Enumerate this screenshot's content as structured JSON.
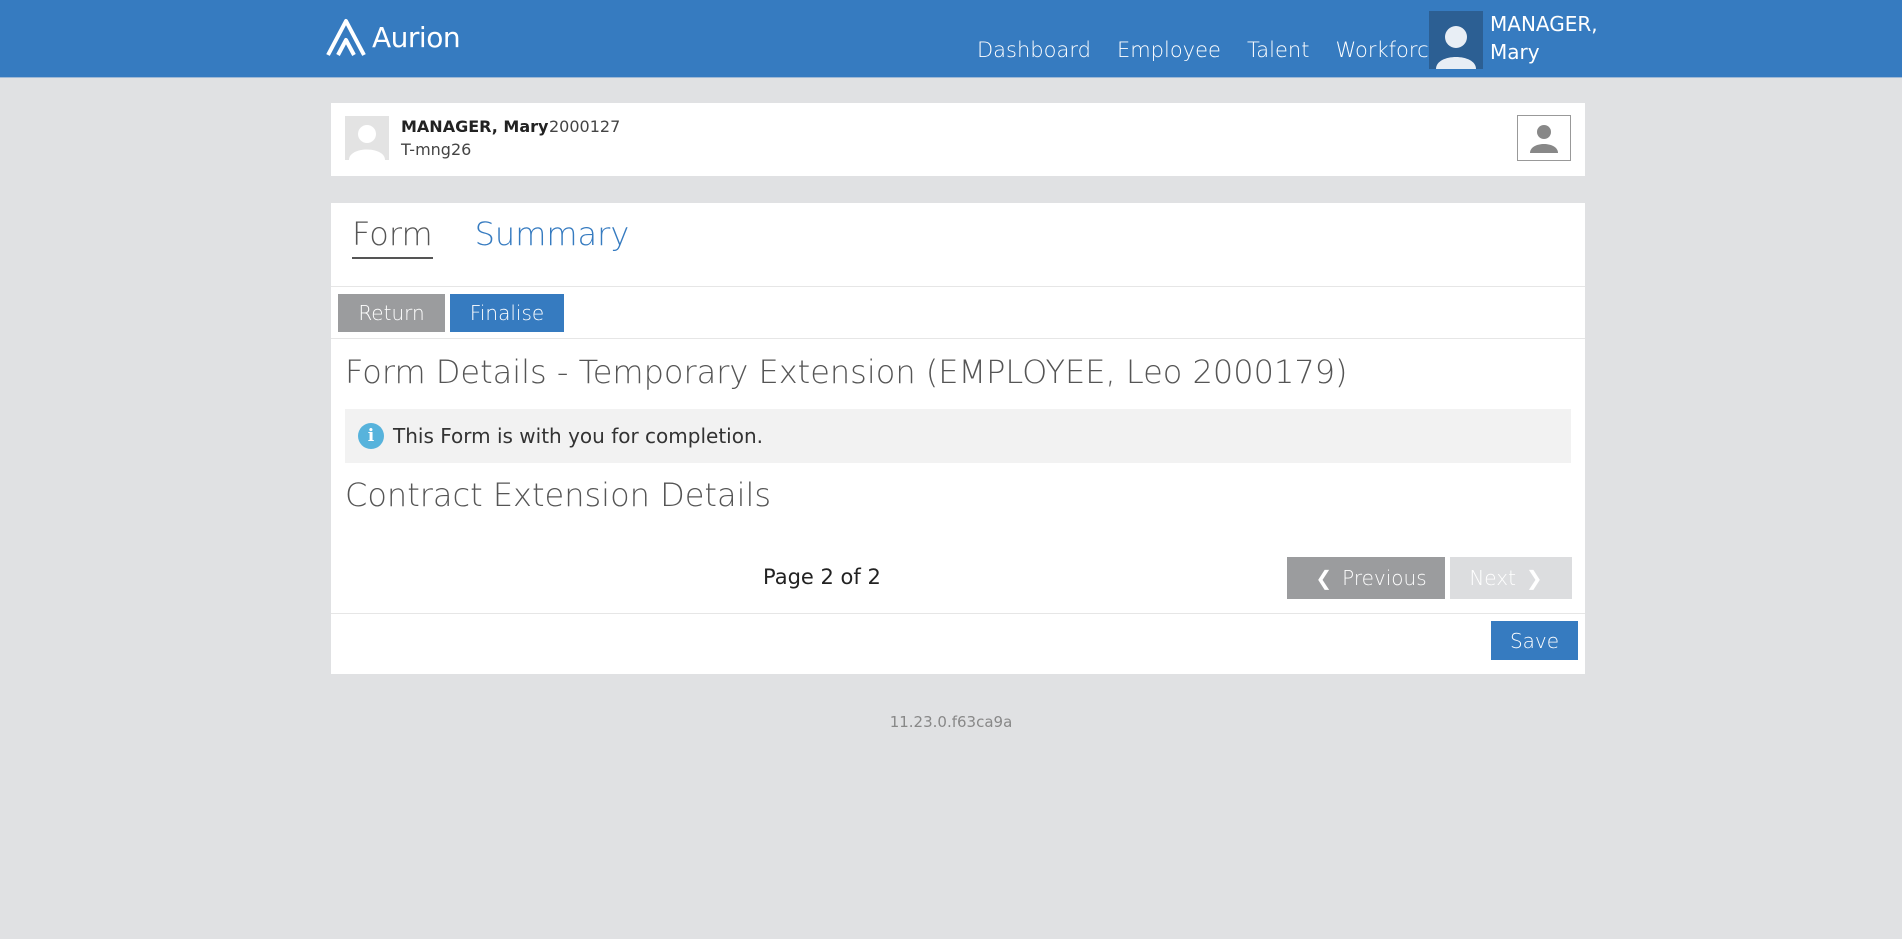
{
  "app": {
    "logo_text": "Aurion"
  },
  "nav": {
    "items": [
      "Dashboard",
      "Employee",
      "Talent",
      "Workforce"
    ]
  },
  "user": {
    "name_line1": "MANAGER,",
    "name_line2": "Mary"
  },
  "employee": {
    "name": "MANAGER, Mary",
    "id": "2000127",
    "username": "T-mng26"
  },
  "tabs": {
    "form": "Form",
    "summary": "Summary"
  },
  "actions": {
    "return_label": "Return",
    "finalise_label": "Finalise"
  },
  "form": {
    "title": "Form Details - Temporary Extension (EMPLOYEE, Leo 2000179)",
    "info_message": "This Form is with you for completion.",
    "section_title": "Contract Extension Details"
  },
  "pagination": {
    "page_info": "Page 2 of 2",
    "previous_label": "Previous",
    "next_label": "Next"
  },
  "footer_actions": {
    "save_label": "Save"
  },
  "version": "11.23.0.f63ca9a",
  "colors": {
    "brand": "#367bc0",
    "background": "#e0e1e3",
    "button_grey": "#9b9c9e",
    "info_icon": "#57b3dc"
  }
}
